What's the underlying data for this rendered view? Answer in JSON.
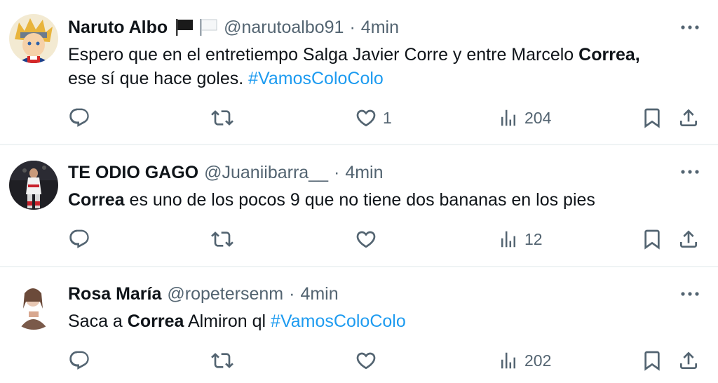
{
  "tweets": [
    {
      "display_name": "Naruto Albo",
      "flags": [
        "black-flag-icon",
        "white-flag-icon"
      ],
      "handle": "@narutoalbo91",
      "separator": "·",
      "time": "4min",
      "text_segments": [
        {
          "t": "Espero que en el entretiempo Salga Javier Corre y entre Marcelo "
        },
        {
          "t": "Correa",
          "b": true
        },
        {
          "t": ","
        },
        {
          "t": "ese sí que hace goles. "
        },
        {
          "t": "#VamosColoColo",
          "h": true
        }
      ],
      "likes": "1",
      "views": "204"
    },
    {
      "display_name": "TE ODIO GAGO",
      "handle": "@Juaniibarra__",
      "separator": "·",
      "time": "4min",
      "text_segments": [
        {
          "t": "Correa",
          "b": true
        },
        {
          "t": " es uno de los pocos 9 que no tiene dos bananas en los pies"
        }
      ],
      "likes": "",
      "views": "12"
    },
    {
      "display_name": "Rosa María",
      "handle": "@ropetersenm",
      "separator": "·",
      "time": "4min",
      "text_segments": [
        {
          "t": "Saca a "
        },
        {
          "t": "Correa",
          "b": true
        },
        {
          "t": " Almiron ql "
        },
        {
          "t": "#VamosColoColo",
          "h": true
        }
      ],
      "likes": "",
      "views": "202"
    }
  ],
  "colors": {
    "text": "#0f1419",
    "secondary": "#536471",
    "link": "#1d9bf0",
    "divider": "#eff3f4"
  },
  "icons": [
    "reply-icon",
    "retweet-icon",
    "like-icon",
    "views-icon",
    "bookmark-icon",
    "share-icon",
    "more-icon"
  ]
}
